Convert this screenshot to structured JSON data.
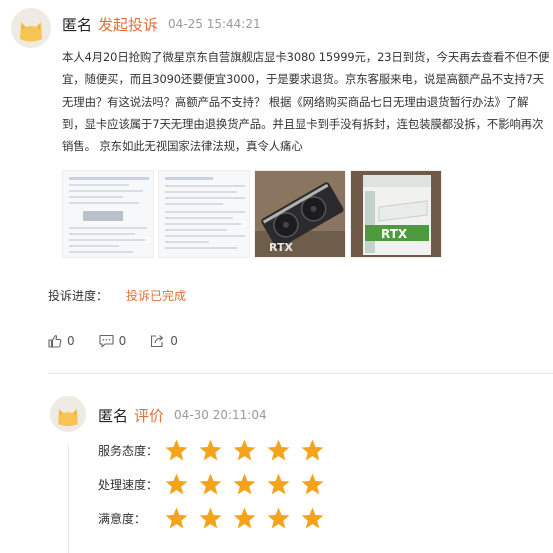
{
  "post": {
    "author": "匿名",
    "action": "发起投诉",
    "time": "04-25 15:44:21",
    "body": "本人4月20日抢购了微星京东自营旗舰店显卡3080 15999元，23日到货，今天再去查看不但不便宜，随便买，而且3090还要便宜3000，于是要求退货。京东客服来电，说是高额产品不支持7天无理由？有这说法吗？高额产品不支持？ 根据《网络购买商品七日无理由退货暂行办法》了解到，显卡应该属于7天无理由退换货产品。并且显卡到手没有拆封，连包装膜都没拆，不影响再次销售。 京东如此无视国家法律法规，真令人痛心",
    "images": [
      {
        "icon": "document-screenshot-image"
      },
      {
        "icon": "document-screenshot-image"
      },
      {
        "icon": "graphics-card-photo",
        "label": "RTX"
      },
      {
        "icon": "graphics-card-box-photo",
        "label": "RTX"
      }
    ]
  },
  "status": {
    "label": "投诉进度：",
    "value": "投诉已完成"
  },
  "actions": {
    "like_count": "0",
    "comment_count": "0",
    "share_count": "0"
  },
  "review": {
    "author": "匿名",
    "action": "评价",
    "time": "04-30 20:11:04",
    "ratings": [
      {
        "label": "服务态度：",
        "stars": 5
      },
      {
        "label": "处理速度：",
        "stars": 5
      },
      {
        "label": "满意度：",
        "stars": 5
      }
    ]
  },
  "colors": {
    "accent": "#e0703a",
    "star": "#f3a41b",
    "muted": "#9a9a9a"
  }
}
